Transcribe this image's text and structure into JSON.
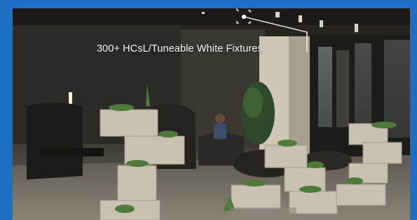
{
  "photo": {
    "caption": "300+ HCsL/Tuneable White Fixtures"
  },
  "colors": {
    "frame": "#1d6fc6",
    "caption_text": "#ffffff",
    "callout_line": "#ffffff"
  },
  "icons": [
    "fixture-marker-icon"
  ]
}
